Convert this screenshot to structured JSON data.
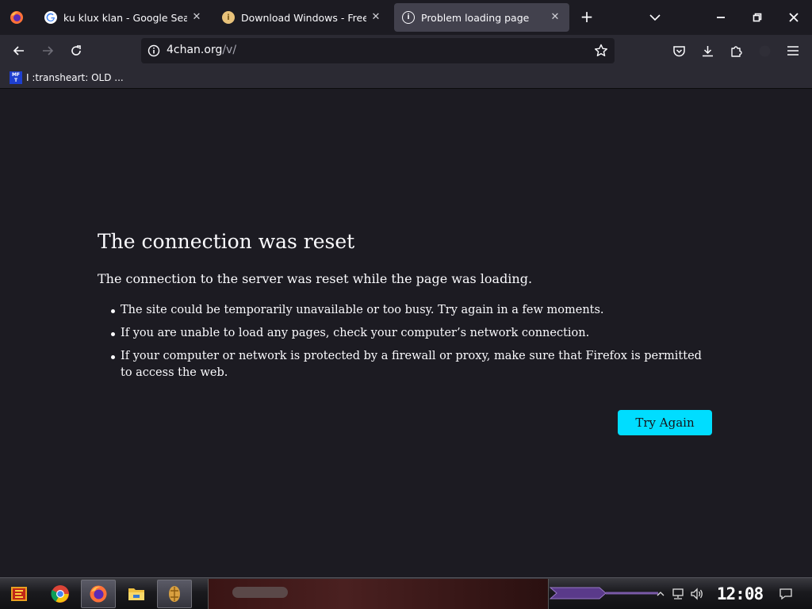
{
  "browser": {
    "tabs": [
      {
        "title": "ku klux klan - Google Search",
        "favicon": "google-icon",
        "active": false
      },
      {
        "title": "Download Windows - Free Res",
        "favicon": "download-site-icon",
        "active": false
      },
      {
        "title": "Problem loading page",
        "favicon": "info-icon",
        "active": true
      }
    ],
    "address": {
      "host": "4chan.org",
      "path": "/v/"
    },
    "bookmarks": [
      {
        "label": "I :transheart: OLD ...",
        "favicon_text": "MF T"
      }
    ]
  },
  "error_page": {
    "title": "The connection was reset",
    "description": "The connection to the server was reset while the page was loading.",
    "suggestions": [
      "The site could be temporarily unavailable or too busy. Try again in a few moments.",
      "If you are unable to load any pages, check your computer’s network connection.",
      "If your computer or network is protected by a firewall or proxy, make sure that Firefox is permitted to access the web."
    ],
    "try_again_label": "Try Again",
    "accent_color": "#00ddff"
  },
  "taskbar": {
    "clock": "12:08 PM",
    "pinned": [
      "start-icon",
      "chrome-icon",
      "firefox-icon",
      "file-explorer-icon",
      "app-icon"
    ]
  }
}
